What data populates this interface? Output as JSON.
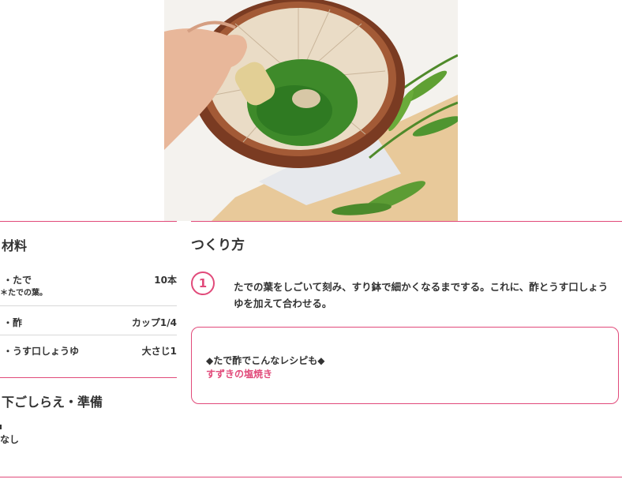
{
  "ingredients": {
    "heading": "材料",
    "items": [
      {
        "name": "・たで",
        "amount": "10本",
        "note": "＊たでの葉。"
      },
      {
        "name": "・酢",
        "amount": "カップ1/4"
      },
      {
        "name": "・うす口しょうゆ",
        "amount": "大さじ1"
      }
    ]
  },
  "prep": {
    "heading": "下ごしらえ・準備",
    "text": "なし"
  },
  "method": {
    "heading": "つくり方",
    "steps": [
      {
        "number": "1",
        "text": "たでの葉をしごいて刻み、すり鉢で細かくなるまでする。これに、酢とうす口しょうゆを加えて合わせる。"
      }
    ]
  },
  "tip": {
    "label": "◆たで酢でこんなレシピも◆",
    "link": "すずきの塩焼き"
  },
  "colors": {
    "accent": "#e14a7a",
    "text": "#333333"
  }
}
